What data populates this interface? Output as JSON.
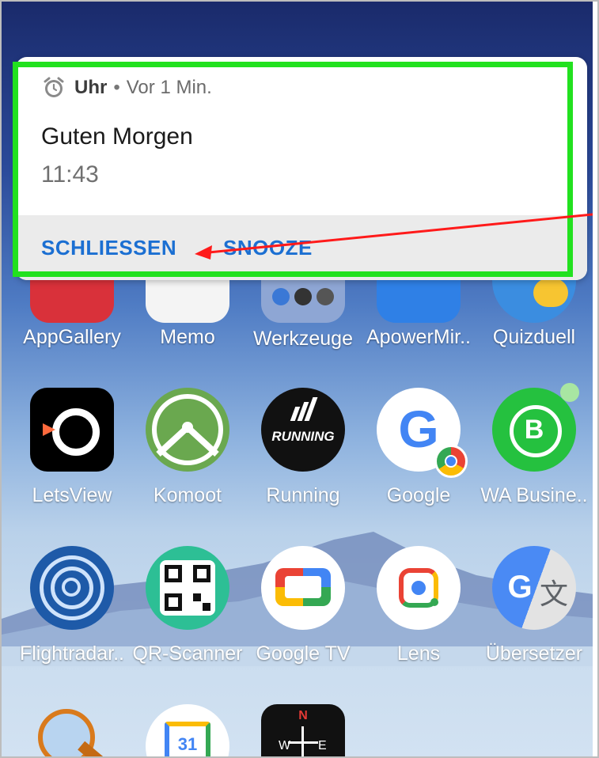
{
  "notification": {
    "app_name": "Uhr",
    "separator": "•",
    "time_ago": "Vor 1 Min.",
    "title": "Guten Morgen",
    "text": "11:43",
    "actions": [
      "SCHLIESSEN",
      "SNOOZE"
    ]
  },
  "apps": [
    {
      "label": "AppGallery",
      "icon": "appgallery-icon"
    },
    {
      "label": "Memo",
      "icon": "memo-icon"
    },
    {
      "label": "Werkzeuge",
      "icon": "folder-icon"
    },
    {
      "label": "ApowerMir..",
      "icon": "apowermirror-icon"
    },
    {
      "label": "Quizduell",
      "icon": "quizduell-icon"
    },
    {
      "label": "LetsView",
      "icon": "letsview-icon"
    },
    {
      "label": "Komoot",
      "icon": "komoot-icon"
    },
    {
      "label": "Running",
      "icon": "running-icon",
      "icon_text": "RUNNING"
    },
    {
      "label": "Google",
      "icon": "google-icon",
      "icon_text": "G"
    },
    {
      "label": "WA Busine..",
      "icon": "whatsapp-business-icon",
      "icon_text": "B"
    },
    {
      "label": "Flightradar..",
      "icon": "flightradar-icon"
    },
    {
      "label": "QR-Scanner",
      "icon": "qr-scanner-icon"
    },
    {
      "label": "Google TV",
      "icon": "google-tv-icon"
    },
    {
      "label": "Lens",
      "icon": "lens-icon"
    },
    {
      "label": "Übersetzer",
      "icon": "translate-icon",
      "icon_text": "G"
    },
    {
      "label": "",
      "icon": "magnifier-icon"
    },
    {
      "label": "",
      "icon": "calendar-icon",
      "icon_text": "31"
    },
    {
      "label": "",
      "icon": "compass-icon",
      "icon_text": "N"
    }
  ],
  "colors": {
    "highlight": "#22e11f",
    "arrow": "#ff1a1a",
    "action_text": "#1b6fd2"
  }
}
